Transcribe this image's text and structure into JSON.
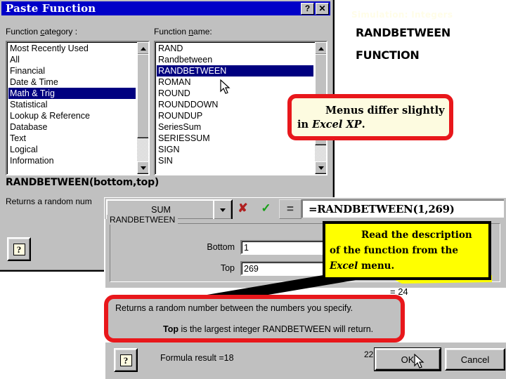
{
  "paste_function_dialog": {
    "title": "Paste Function",
    "titlebar_buttons": [
      {
        "name": "help",
        "glyph": "?"
      },
      {
        "name": "close",
        "glyph": "✕"
      }
    ],
    "category_label_pre": "Function ",
    "category_label_accel": "c",
    "category_label_post": "ategory :",
    "name_label_pre": "Function ",
    "name_label_accel": "n",
    "name_label_post": "ame:",
    "categories": [
      "Most Recently Used",
      "All",
      "Financial",
      "Date & Time",
      "Math & Trig",
      "Statistical",
      "Lookup & Reference",
      "Database",
      "Text",
      "Logical",
      "Information"
    ],
    "category_selected": "Math & Trig",
    "function_names": [
      "RAND",
      "Randbetween",
      "RANDBETWEEN",
      "ROMAN",
      "ROUND",
      "ROUNDDOWN",
      "ROUNDUP",
      "SeriesSum",
      "SERIESSUM",
      "SIGN",
      "SIN"
    ],
    "function_selected": "RANDBETWEEN",
    "syntax": "RANDBETWEEN(bottom,top)",
    "description_truncated": "Returns a random num",
    "help_glyph": "?"
  },
  "heading": {
    "faint_line": "Simulation: Integers",
    "line1": "RANDBETWEEN",
    "line2": "FUNCTION"
  },
  "callout_menus": {
    "line1_indent": "",
    "line1": "Menus differ slightly",
    "line2_pre": "in ",
    "line2_em": "Excel XP",
    "line2_post": "."
  },
  "formula_bar": {
    "name_box_value": "SUM",
    "dropdown_icon": "chevron-down-icon",
    "cancel_icon": "✘",
    "enter_icon": "✓",
    "equals_icon": "=",
    "formula": "=RANDBETWEEN(1,269)"
  },
  "function_arguments": {
    "group_title": "RANDBETWEEN",
    "args": [
      {
        "label": "Bottom",
        "value": "1"
      },
      {
        "label": "Top",
        "value": "269"
      }
    ],
    "partial_equals": "= 24",
    "help_glyph": "?",
    "formula_result": "Formula result =18",
    "ok_label": "OK",
    "cancel_label": "Cancel"
  },
  "callout_read": {
    "line1_indent": "",
    "line1": "Read the description",
    "line2": "of the function from the",
    "line3_em": "Excel",
    "line3_post": " menu."
  },
  "callout_description": {
    "line1": "Returns a random number between the numbers you specify.",
    "line2_bold": "Top",
    "line2_rest": " is the largest integer RANDBETWEEN will return."
  },
  "slide_number": "22",
  "colors": {
    "titlebar_blue": "#0000c8",
    "selection_navy": "#000080",
    "face_gray": "#c0c0c0",
    "callout_red": "#e8171b",
    "callout_yellow": "#ffff00",
    "callout_cream": "#fdfbe0",
    "check_green": "#18a018",
    "cross_red": "#b02020"
  }
}
